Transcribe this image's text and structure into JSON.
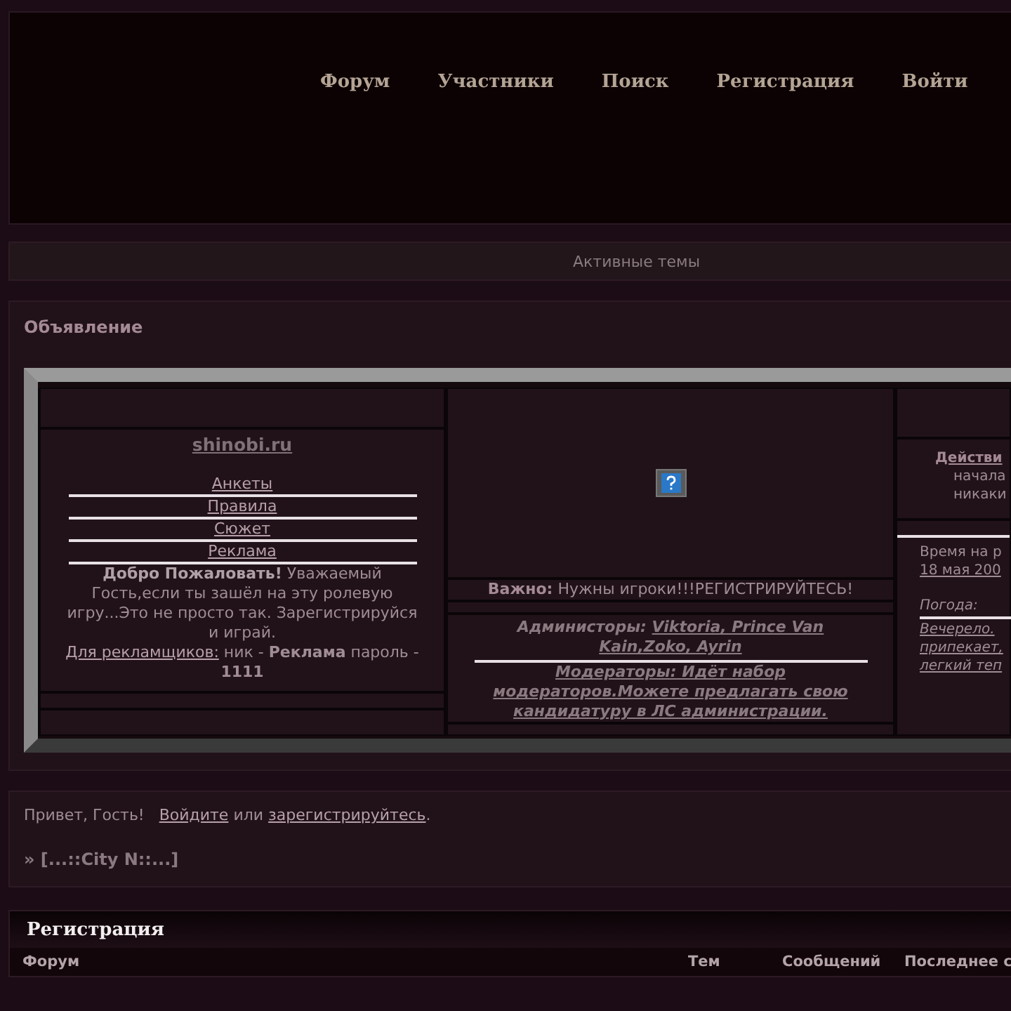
{
  "nav": [
    {
      "label": "Форум"
    },
    {
      "label": "Участники"
    },
    {
      "label": "Поиск"
    },
    {
      "label": "Регистрация"
    },
    {
      "label": "Войти"
    }
  ],
  "active_topics": "Активные темы",
  "announcement": {
    "title": "Объявление",
    "left": {
      "site": "shinobi.ru",
      "links": [
        "Анкеты",
        "Правила",
        "Сюжет",
        "Реклама"
      ],
      "welcome": "**Добро Пожаловать!** Уважаемый Гость,если ты зашёл на эту ролевую игру...Это не просто так. Зарегистрируйся и играй.",
      "ads_label": "Для рекламщиков:",
      "ads_text": "ник - **Реклама** пароль - **1111**"
    },
    "center": {
      "important_label": "Важно:",
      "important_text": "Нужны игроки!!!РЕГИСТРИРУЙТЕСЬ!",
      "admins_label": "Администоры:",
      "admins": "Viktoria, Prince Van Kain,Zoko, Ayrin",
      "moderators": "Модераторы: Идёт набор модераторов.Можете предлагать свою кандидатуру в ЛС администрации."
    },
    "right": {
      "action_title": "Действи",
      "action_lines": [
        "начала",
        "никаки"
      ],
      "time_lines": [
        "Время на р",
        "18 мая 200"
      ],
      "weather_label": "Погода:",
      "weather_lines": [
        "Вечерело.",
        "припекает,",
        "легкий теп"
      ]
    }
  },
  "welcome_bar": {
    "greeting": "Привет, Гость!",
    "login": "Войдите",
    "or": "или",
    "register": "зарегистрируйтесь",
    "period": ".",
    "breadcrumb": "» [...::City N::...]"
  },
  "category": {
    "title": "Регистрация",
    "columns": [
      "Форум",
      "Тем",
      "Сообщений",
      "Последнее с"
    ]
  }
}
